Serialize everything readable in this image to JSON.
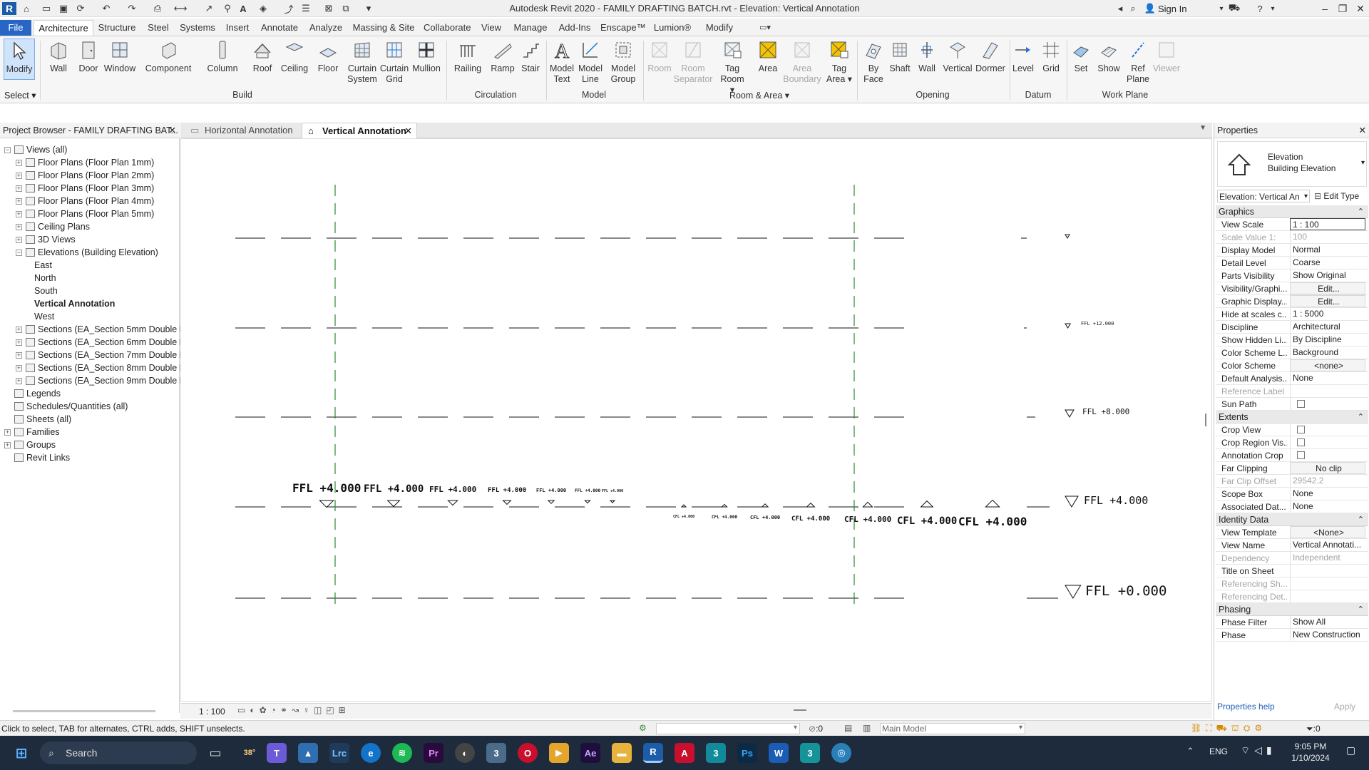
{
  "window": {
    "title": "Autodesk Revit 2020 - FAMILY DRAFTING BATCH.rvt - Elevation: Vertical Annotation",
    "sign_in": "Sign In"
  },
  "menu": {
    "tabs": [
      "File",
      "Architecture",
      "Structure",
      "Steel",
      "Systems",
      "Insert",
      "Annotate",
      "Analyze",
      "Massing & Site",
      "Collaborate",
      "View",
      "Manage",
      "Add-Ins",
      "Enscape™",
      "Lumion®",
      "Modify"
    ],
    "active": "Architecture"
  },
  "ribbon": {
    "modify": "Modify",
    "select_label": "Select",
    "build": {
      "label": "Build",
      "items": [
        "Wall",
        "Door",
        "Window",
        "Component",
        "Column",
        "Roof",
        "Ceiling",
        "Floor",
        "Curtain System",
        "Curtain Grid",
        "Mullion"
      ]
    },
    "circulation": {
      "label": "Circulation",
      "items": [
        "Railing",
        "Ramp",
        "Stair"
      ]
    },
    "model": {
      "label": "Model",
      "items": [
        "Model Text",
        "Model Line",
        "Model Group"
      ]
    },
    "room_area": {
      "label": "Room & Area",
      "items": [
        "Room",
        "Room Separator",
        "Tag Room",
        "Area",
        "Area Boundary",
        "Tag Area"
      ]
    },
    "opening": {
      "label": "Opening",
      "items": [
        "By Face",
        "Shaft",
        "Wall",
        "Vertical",
        "Dormer"
      ]
    },
    "datum": {
      "label": "Datum",
      "items": [
        "Level",
        "Grid"
      ]
    },
    "work_plane": {
      "label": "Work Plane",
      "items": [
        "Set",
        "Show",
        "Ref Plane",
        "Viewer"
      ]
    }
  },
  "project_browser": {
    "title": "Project Browser - FAMILY DRAFTING BAT...",
    "nodes": [
      {
        "label": "Views (all)",
        "level": 0,
        "toggle": "−"
      },
      {
        "label": "Floor Plans (Floor Plan 1mm)",
        "level": 1,
        "toggle": "+"
      },
      {
        "label": "Floor Plans (Floor Plan 2mm)",
        "level": 1,
        "toggle": "+"
      },
      {
        "label": "Floor Plans (Floor Plan 3mm)",
        "level": 1,
        "toggle": "+"
      },
      {
        "label": "Floor Plans (Floor Plan 4mm)",
        "level": 1,
        "toggle": "+"
      },
      {
        "label": "Floor Plans (Floor Plan 5mm)",
        "level": 1,
        "toggle": "+"
      },
      {
        "label": "Ceiling Plans",
        "level": 1,
        "toggle": "+"
      },
      {
        "label": "3D Views",
        "level": 1,
        "toggle": "+"
      },
      {
        "label": "Elevations (Building Elevation)",
        "level": 1,
        "toggle": "−"
      },
      {
        "label": "East",
        "level": 2,
        "toggle": ""
      },
      {
        "label": "North",
        "level": 2,
        "toggle": ""
      },
      {
        "label": "South",
        "level": 2,
        "toggle": ""
      },
      {
        "label": "Vertical Annotation",
        "level": 2,
        "toggle": "",
        "selected": true
      },
      {
        "label": "West",
        "level": 2,
        "toggle": ""
      },
      {
        "label": "Sections (EA_Section 5mm Double Hea",
        "level": 1,
        "toggle": "+"
      },
      {
        "label": "Sections (EA_Section 6mm Double Hea",
        "level": 1,
        "toggle": "+"
      },
      {
        "label": "Sections (EA_Section 7mm Double Hea",
        "level": 1,
        "toggle": "+"
      },
      {
        "label": "Sections (EA_Section 8mm Double Hea",
        "level": 1,
        "toggle": "+"
      },
      {
        "label": "Sections (EA_Section 9mm Double Hea",
        "level": 1,
        "toggle": "+"
      },
      {
        "label": "Legends",
        "level": 0,
        "toggle": ""
      },
      {
        "label": "Schedules/Quantities (all)",
        "level": 0,
        "toggle": ""
      },
      {
        "label": "Sheets (all)",
        "level": 0,
        "toggle": ""
      },
      {
        "label": "Families",
        "level": 0,
        "toggle": "+"
      },
      {
        "label": "Groups",
        "level": 0,
        "toggle": "+"
      },
      {
        "label": "Revit Links",
        "level": 0,
        "toggle": ""
      }
    ]
  },
  "view_tabs": [
    {
      "label": "Horizontal Annotation",
      "active": false
    },
    {
      "label": "Vertical Annotation",
      "active": true
    }
  ],
  "drawing": {
    "level_tags": [
      "FFL +12.000",
      "FFL +8.000",
      "FFL +4.000",
      "FFL +0.000"
    ],
    "ffl_label": "FFL +4.000",
    "cfl_label": "CFL +4.000"
  },
  "view_control": {
    "scale": "1 : 100"
  },
  "properties": {
    "title": "Properties",
    "family": "Elevation",
    "type": "Building Elevation",
    "selector": "Elevation: Vertical An",
    "edit_type": "Edit Type",
    "sections": [
      {
        "name": "Graphics",
        "rows": [
          {
            "label": "View Scale",
            "value": "1 : 100"
          },
          {
            "label": "Scale Value 1:",
            "value": "100",
            "disabled": true
          },
          {
            "label": "Display Model",
            "value": "Normal"
          },
          {
            "label": "Detail Level",
            "value": "Coarse"
          },
          {
            "label": "Parts Visibility",
            "value": "Show Original"
          },
          {
            "label": "Visibility/Graphi...",
            "value": "Edit...",
            "button": true
          },
          {
            "label": "Graphic Display...",
            "value": "Edit...",
            "button": true
          },
          {
            "label": "Hide at scales c...",
            "value": "1 : 5000"
          },
          {
            "label": "Discipline",
            "value": "Architectural"
          },
          {
            "label": "Show Hidden Li...",
            "value": "By Discipline"
          },
          {
            "label": "Color Scheme L...",
            "value": "Background"
          },
          {
            "label": "Color Scheme",
            "value": "<none>",
            "button": true
          },
          {
            "label": "Default Analysis...",
            "value": "None"
          },
          {
            "label": "Reference Label",
            "value": "",
            "disabled": true
          },
          {
            "label": "Sun Path",
            "value": "",
            "checkbox": true
          }
        ]
      },
      {
        "name": "Extents",
        "rows": [
          {
            "label": "Crop View",
            "value": "",
            "checkbox": true
          },
          {
            "label": "Crop Region Vis...",
            "value": "",
            "checkbox": true
          },
          {
            "label": "Annotation Crop",
            "value": "",
            "checkbox": true
          },
          {
            "label": "Far Clipping",
            "value": "No clip",
            "button": true
          },
          {
            "label": "Far Clip Offset",
            "value": "29542.2",
            "disabled": true
          },
          {
            "label": "Scope Box",
            "value": "None"
          },
          {
            "label": "Associated Dat...",
            "value": "None"
          }
        ]
      },
      {
        "name": "Identity Data",
        "rows": [
          {
            "label": "View Template",
            "value": "<None>",
            "button": true
          },
          {
            "label": "View Name",
            "value": "Vertical Annotati..."
          },
          {
            "label": "Dependency",
            "value": "Independent",
            "disabled": true
          },
          {
            "label": "Title on Sheet",
            "value": ""
          },
          {
            "label": "Referencing Sh...",
            "value": "",
            "disabled": true
          },
          {
            "label": "Referencing Det...",
            "value": "",
            "disabled": true
          }
        ]
      },
      {
        "name": "Phasing",
        "rows": [
          {
            "label": "Phase Filter",
            "value": "Show All"
          },
          {
            "label": "Phase",
            "value": "New Construction"
          }
        ]
      }
    ],
    "help": "Properties help",
    "apply": "Apply"
  },
  "status": {
    "hint": "Click to select, TAB for alternates, CTRL adds, SHIFT unselects.",
    "counter": ":0",
    "model": "Main Model",
    "filter_count": ":0"
  },
  "taskbar": {
    "search": "Search",
    "weather": "38°",
    "lang": "ENG",
    "time": "9:05 PM",
    "date": "1/10/2024"
  }
}
